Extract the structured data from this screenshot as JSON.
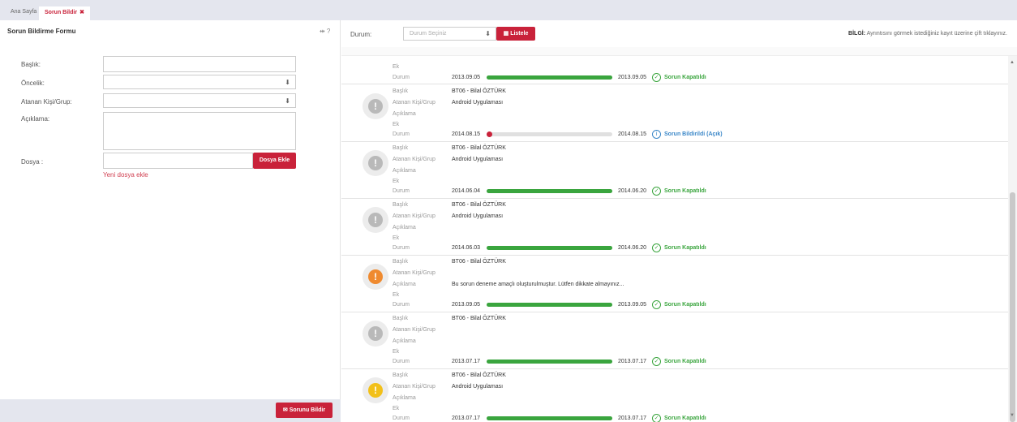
{
  "tabs": {
    "home": "Ana Sayfa",
    "active": "Sorun Bildir",
    "close": "✖"
  },
  "form": {
    "title": "Sorun Bildirme Formu",
    "icons": "⇹ ?",
    "labels": {
      "baslik": "Başlık:",
      "oncelik": "Öncelik:",
      "atanan": "Atanan Kişi/Grup:",
      "aciklama": "Açıklama:",
      "dosya": "Dosya :"
    },
    "select_arrow": "⬇",
    "dosya_ekle": "Dosya Ekle",
    "new_file": "Yeni dosya ekle",
    "submit": "Sorunu Bildir"
  },
  "filter": {
    "label": "Durum:",
    "placeholder": "Durum Seçiniz",
    "arrow": "⬇",
    "list_button": "Listele",
    "info_bold": "BİLGİ:",
    "info_text": "Ayrıntısını görmek istediğiniz kayıt üzerine çift tıklayınız."
  },
  "field_labels": {
    "baslik": "Başlık",
    "atanan": "Atanan Kişi/Grup",
    "aciklama": "Açıklama",
    "ek": "Ek",
    "durum": "Durum"
  },
  "partial": {
    "start": "2013.09.05",
    "end": "2013.09.05",
    "status": "Sorun Kapatıldı",
    "progress": 1.0
  },
  "items": [
    {
      "title": "BT06 - Bilal ÖZTÜRK",
      "assignee": "Android Uygulaması",
      "description": "",
      "start": "2014.08.15",
      "end": "2014.08.15",
      "status": "Sorun Bildirildi (Açık)",
      "status_kind": "open",
      "progress": 0.0,
      "avatar_color": "#b9b9b9"
    },
    {
      "title": "BT06 - Bilal ÖZTÜRK",
      "assignee": "Android Uygulaması",
      "description": "",
      "start": "2014.06.04",
      "end": "2014.06.20",
      "status": "Sorun Kapatıldı",
      "status_kind": "closed",
      "progress": 1.0,
      "avatar_color": "#b9b9b9"
    },
    {
      "title": "BT06 - Bilal ÖZTÜRK",
      "assignee": "Android Uygulaması",
      "description": "",
      "start": "2014.06.03",
      "end": "2014.06.20",
      "status": "Sorun Kapatıldı",
      "status_kind": "closed",
      "progress": 1.0,
      "avatar_color": "#b9b9b9"
    },
    {
      "title": "BT06 - Bilal ÖZTÜRK",
      "assignee": "",
      "description": "Bu sorun deneme amaçlı oluşturulmuştur. Lütfen dikkate almayınız...",
      "start": "2013.09.05",
      "end": "2013.09.05",
      "status": "Sorun Kapatıldı",
      "status_kind": "closed",
      "progress": 1.0,
      "avatar_color": "#ef8a2f"
    },
    {
      "title": "BT06 - Bilal ÖZTÜRK",
      "assignee": "",
      "description": "",
      "start": "2013.07.17",
      "end": "2013.07.17",
      "status": "Sorun Kapatıldı",
      "status_kind": "closed",
      "progress": 1.0,
      "avatar_color": "#b9b9b9"
    },
    {
      "title": "BT06 - Bilal ÖZTÜRK",
      "assignee": "Android Uygulaması",
      "description": "",
      "start": "2013.07.17",
      "end": "2013.07.17",
      "status": "Sorun Kapatıldı",
      "status_kind": "closed",
      "progress": 1.0,
      "avatar_color": "#f2c019"
    }
  ],
  "colors": {
    "accent": "#c9223a",
    "closed": "#3aa53e",
    "open": "#3a87c8",
    "open_dot": "#c9223a"
  },
  "icons": {
    "avatar": "exclamation-icon",
    "closed": "check-circle-icon",
    "open": "info-circle-icon",
    "scroll_up": "▲",
    "scroll_down": "▼"
  }
}
